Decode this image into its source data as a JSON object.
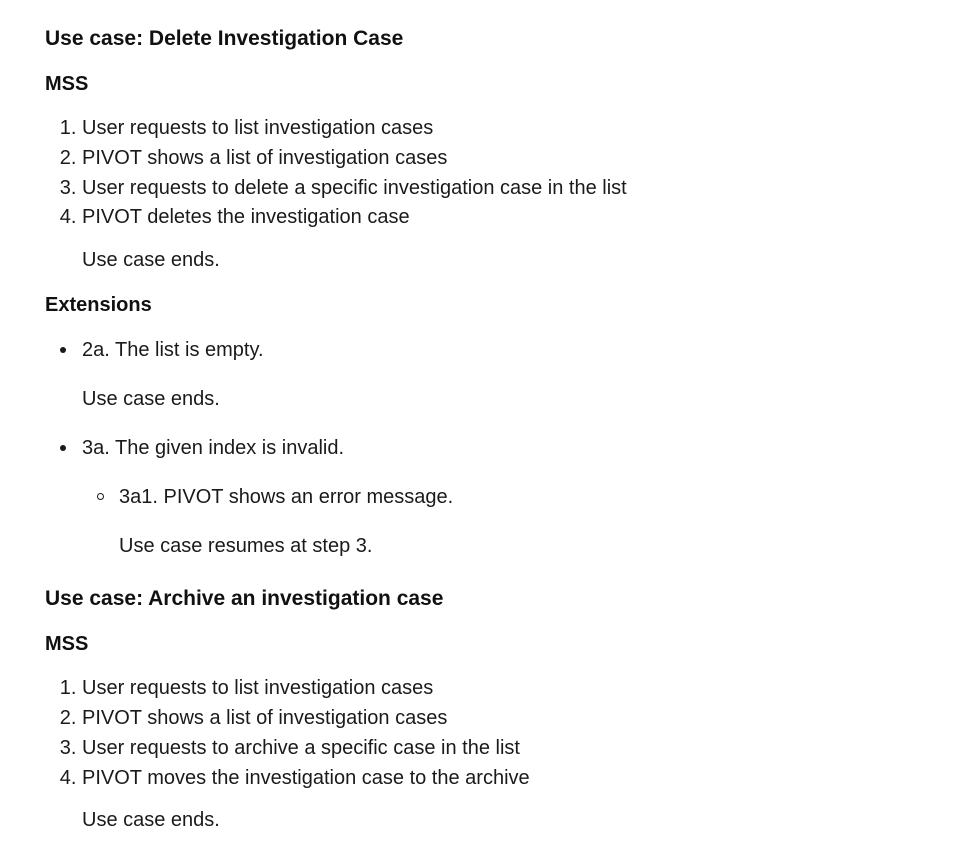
{
  "use_case_1": {
    "title": "Use case: Delete Investigation Case",
    "mss_heading": "MSS",
    "steps": [
      "User requests to list investigation cases",
      "PIVOT shows a list of investigation cases",
      "User requests to delete a specific investigation case in the list",
      "PIVOT deletes the investigation case"
    ],
    "ends": "Use case ends.",
    "extensions_heading": "Extensions",
    "extensions": [
      {
        "text": "2a. The list is empty.",
        "note": "Use case ends."
      },
      {
        "text": "3a. The given index is invalid.",
        "sub": {
          "text": "3a1. PIVOT shows an error message.",
          "note": "Use case resumes at step 3."
        }
      }
    ]
  },
  "use_case_2": {
    "title": "Use case: Archive an investigation case",
    "mss_heading": "MSS",
    "steps": [
      "User requests to list investigation cases",
      "PIVOT shows a list of investigation cases",
      "User requests to archive a specific case in the list",
      "PIVOT moves the investigation case to the archive"
    ],
    "ends": "Use case ends."
  }
}
